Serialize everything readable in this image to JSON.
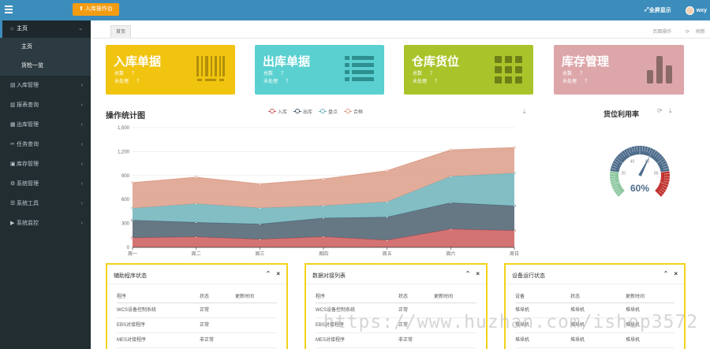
{
  "topbar": {
    "task_button": "入库操作台",
    "fullscreen": "全屏显示",
    "username": "wxy"
  },
  "sidebar": {
    "items": [
      {
        "icon": "home-icon",
        "label": "主页",
        "active": true
      },
      {
        "icon": "inbound-icon",
        "label": "入库管理"
      },
      {
        "icon": "report-icon",
        "label": "报表查询"
      },
      {
        "icon": "outbound-icon",
        "label": "出库管理"
      },
      {
        "icon": "task-icon",
        "label": "任务查询"
      },
      {
        "icon": "warehouse-icon",
        "label": "库存管理"
      },
      {
        "icon": "settings-icon",
        "label": "系统管理"
      },
      {
        "icon": "tools-icon",
        "label": "系统工具"
      },
      {
        "icon": "monitor-icon",
        "label": "系统监控"
      }
    ],
    "sub_items": [
      "主页",
      "货检一览"
    ]
  },
  "tabs": {
    "current": "首页",
    "actions": [
      "页面操作",
      "刷新"
    ]
  },
  "cards": [
    {
      "title": "入库单据",
      "total_label": "总数",
      "total": "7",
      "pending_label": "未处理",
      "pending": "7",
      "color": "#f1c40f",
      "icon": "barcode-icon"
    },
    {
      "title": "出库单据",
      "total_label": "总数",
      "total": "7",
      "pending_label": "未处理",
      "pending": "7",
      "color": "#5bd0d0",
      "icon": "list-icon"
    },
    {
      "title": "仓库货位",
      "total_label": "总数",
      "total": "7",
      "pending_label": "未处理",
      "pending": "7",
      "color": "#a9c42a",
      "icon": "grid-icon"
    },
    {
      "title": "库存管理",
      "total_label": "总数",
      "total": "7",
      "pending_label": "未处理",
      "pending": "7",
      "color": "#dda7aa",
      "icon": "bar-chart-icon"
    }
  ],
  "chart": {
    "title": "操作统计图",
    "legend": [
      "入库",
      "出库",
      "盘点",
      "合框"
    ]
  },
  "chart_data": {
    "type": "area",
    "stacked": true,
    "categories": [
      "周一",
      "周二",
      "周三",
      "周四",
      "周五",
      "周六",
      "周日"
    ],
    "ylim": [
      0,
      1500
    ],
    "yticks": [
      "0",
      "300",
      "600",
      "900",
      "1,200",
      "1,500"
    ],
    "series": [
      {
        "name": "入库",
        "color": "#cc5b5b",
        "values": [
          120,
          132,
          101,
          134,
          90,
          230,
          210
        ]
      },
      {
        "name": "出库",
        "color": "#4c6070",
        "values": [
          220,
          182,
          191,
          234,
          290,
          330,
          310
        ]
      },
      {
        "name": "盘点",
        "color": "#6fb3bb",
        "values": [
          150,
          232,
          201,
          154,
          190,
          330,
          410
        ]
      },
      {
        "name": "合框",
        "color": "#dc9e88",
        "values": [
          320,
          332,
          301,
          334,
          390,
          330,
          320
        ]
      }
    ]
  },
  "gauge": {
    "title": "货位利用率",
    "value": 60,
    "value_label": "60%",
    "ticks": [
      "20",
      "40",
      "60",
      "80"
    ]
  },
  "panels": [
    {
      "title": "辅助程序状态",
      "headers": [
        "程序",
        "状态",
        "更新时间"
      ],
      "rows": [
        [
          "WCS设备控制系统",
          "正常",
          ""
        ],
        [
          "EBS对接程序",
          "正常",
          ""
        ],
        [
          "MES对接程序",
          "非正常",
          ""
        ]
      ]
    },
    {
      "title": "数据对接列表",
      "headers": [
        "程序",
        "状态",
        "更新时间"
      ],
      "rows": [
        [
          "WCS设备控制系统",
          "正常",
          ""
        ],
        [
          "EBS对接程序",
          "正常",
          ""
        ],
        [
          "MES对接程序",
          "非正常",
          ""
        ]
      ]
    },
    {
      "title": "设备运行状态",
      "headers": [
        "设备",
        "状态",
        "更新时间"
      ],
      "rows": [
        [
          "堆垛机",
          "堆垛机",
          "堆垛机"
        ],
        [
          "堆垛机",
          "堆垛机",
          "堆垛机"
        ],
        [
          "堆垛机",
          "堆垛机",
          "堆垛机"
        ]
      ]
    }
  ],
  "watermark": "https://www.huzhan.com/ishop3572"
}
